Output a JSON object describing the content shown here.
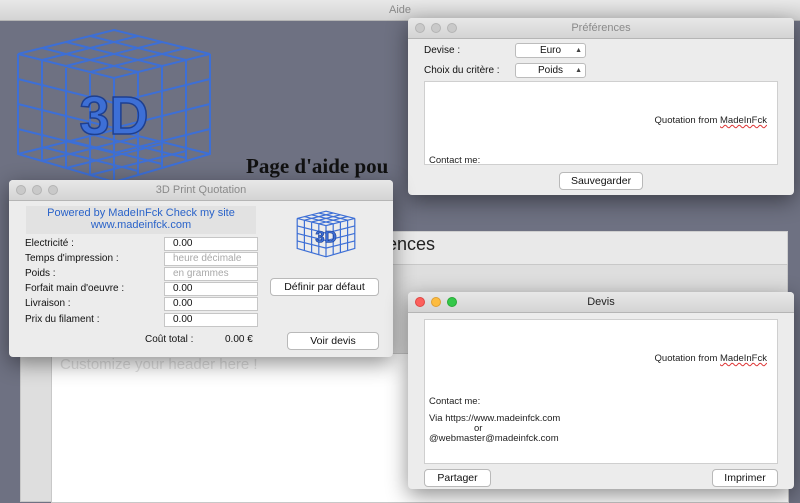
{
  "background_window": {
    "title": "Aide",
    "page_heading": "Page d'aide pou",
    "section_heading": "rences",
    "header_placeholder": "Customize your header here !"
  },
  "preferences": {
    "title": "Préférences",
    "currency_label": "Devise :",
    "currency_value": "Euro",
    "criteria_label": "Choix du critère :",
    "criteria_value": "Poids",
    "preview_text": "Quotation from MadeInFck",
    "contact_label": "Contact me:",
    "save_button": "Sauvegarder"
  },
  "quotation": {
    "title": "3D Print Quotation",
    "powered_line1": "Powered by MadeInFck Check my site",
    "powered_line2": "www.madeinfck.com",
    "fields": [
      {
        "label": "Electricité :",
        "value": "0.00",
        "placeholder": false
      },
      {
        "label": "Temps d'impression :",
        "value": "heure décimale",
        "placeholder": true
      },
      {
        "label": "Poids :",
        "value": "en grammes",
        "placeholder": true
      },
      {
        "label": "Forfait main d'oeuvre :",
        "value": "0.00",
        "placeholder": false
      },
      {
        "label": "Livraison :",
        "value": "0.00",
        "placeholder": false
      },
      {
        "label": "Prix du filament :",
        "value": "0.00",
        "placeholder": false
      }
    ],
    "default_button": "Définir par défaut",
    "total_label": "Coût total :",
    "total_value": "0.00 €",
    "quote_button": "Voir devis"
  },
  "devis": {
    "title": "Devis",
    "quotation_text": "Quotation from MadeInFck",
    "contact_label": "Contact me:",
    "via_line": "Via https://www.madeinfck.com",
    "or_line": "or",
    "email_line": "@webmaster@madeinfck.com",
    "share_button": "Partager",
    "print_button": "Imprimer"
  },
  "colors": {
    "logo_blue": "#3d6fd6",
    "link_blue": "#2a63c9",
    "close_red": "#fc605c",
    "minimize_yellow": "#fdbc40",
    "zoom_green": "#34c84a"
  }
}
